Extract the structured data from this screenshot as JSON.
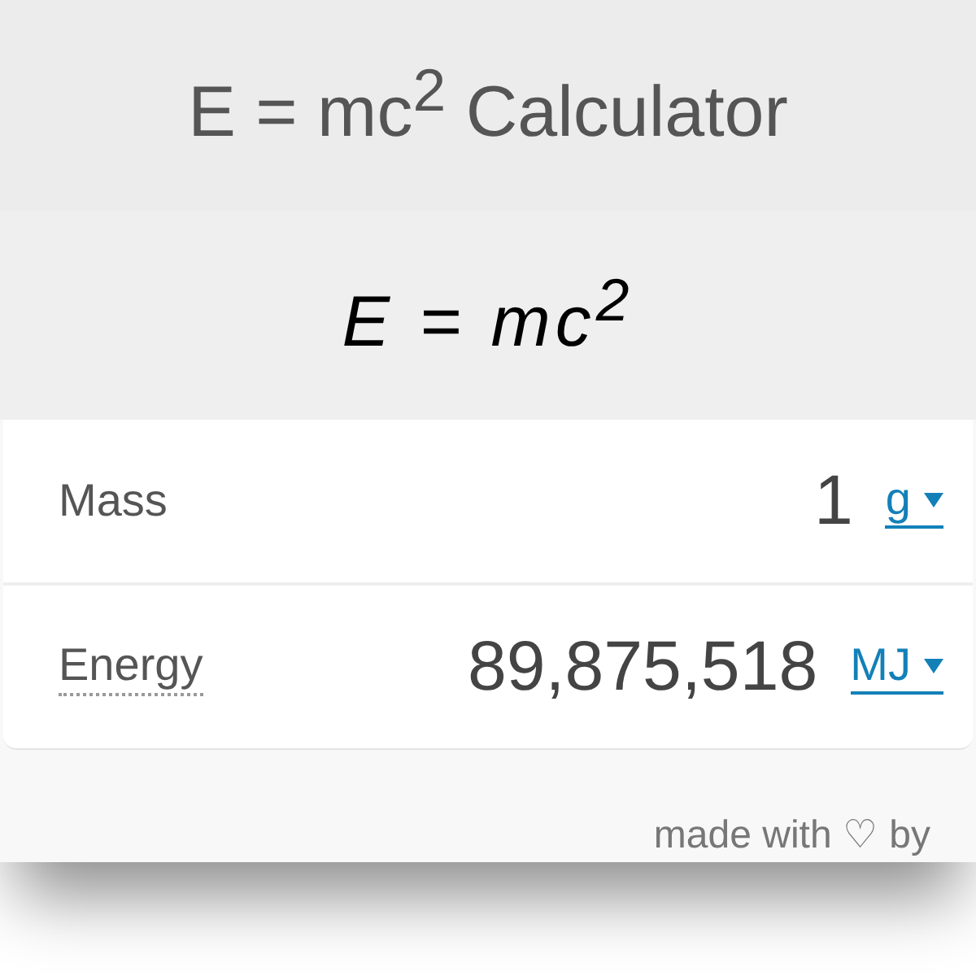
{
  "header": {
    "title": "E = mc$^{2}$ Calculator"
  },
  "formula": "E = mc$^{2}$",
  "fields": [
    {
      "label": "Mass",
      "has_tooltip": false,
      "value": "1",
      "unit": "g"
    },
    {
      "label": "Energy",
      "has_tooltip": true,
      "value": "89,875,518",
      "unit": "MJ"
    }
  ],
  "footer": {
    "credit": "made with ♡ by"
  }
}
